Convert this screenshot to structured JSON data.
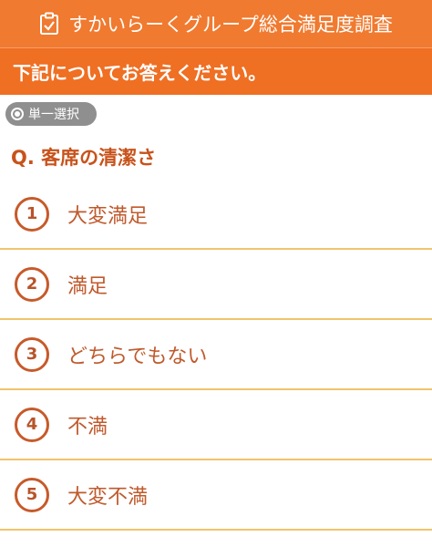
{
  "header": {
    "title": "すかいらーくグループ総合満足度調査",
    "icon": "clipboard-check-icon"
  },
  "instruction": "下記についてお答えください。",
  "badge": {
    "label": "単一選択",
    "icon": "radio-icon"
  },
  "question": "Q. 客席の清潔さ",
  "options": [
    {
      "number": "1",
      "label": "大変満足"
    },
    {
      "number": "2",
      "label": "満足"
    },
    {
      "number": "3",
      "label": "どちらでもない"
    },
    {
      "number": "4",
      "label": "不満"
    },
    {
      "number": "5",
      "label": "大変不満"
    }
  ],
  "colors": {
    "header": "#f07a2f",
    "accent": "#c75a2a",
    "divider": "#f2c46b"
  }
}
